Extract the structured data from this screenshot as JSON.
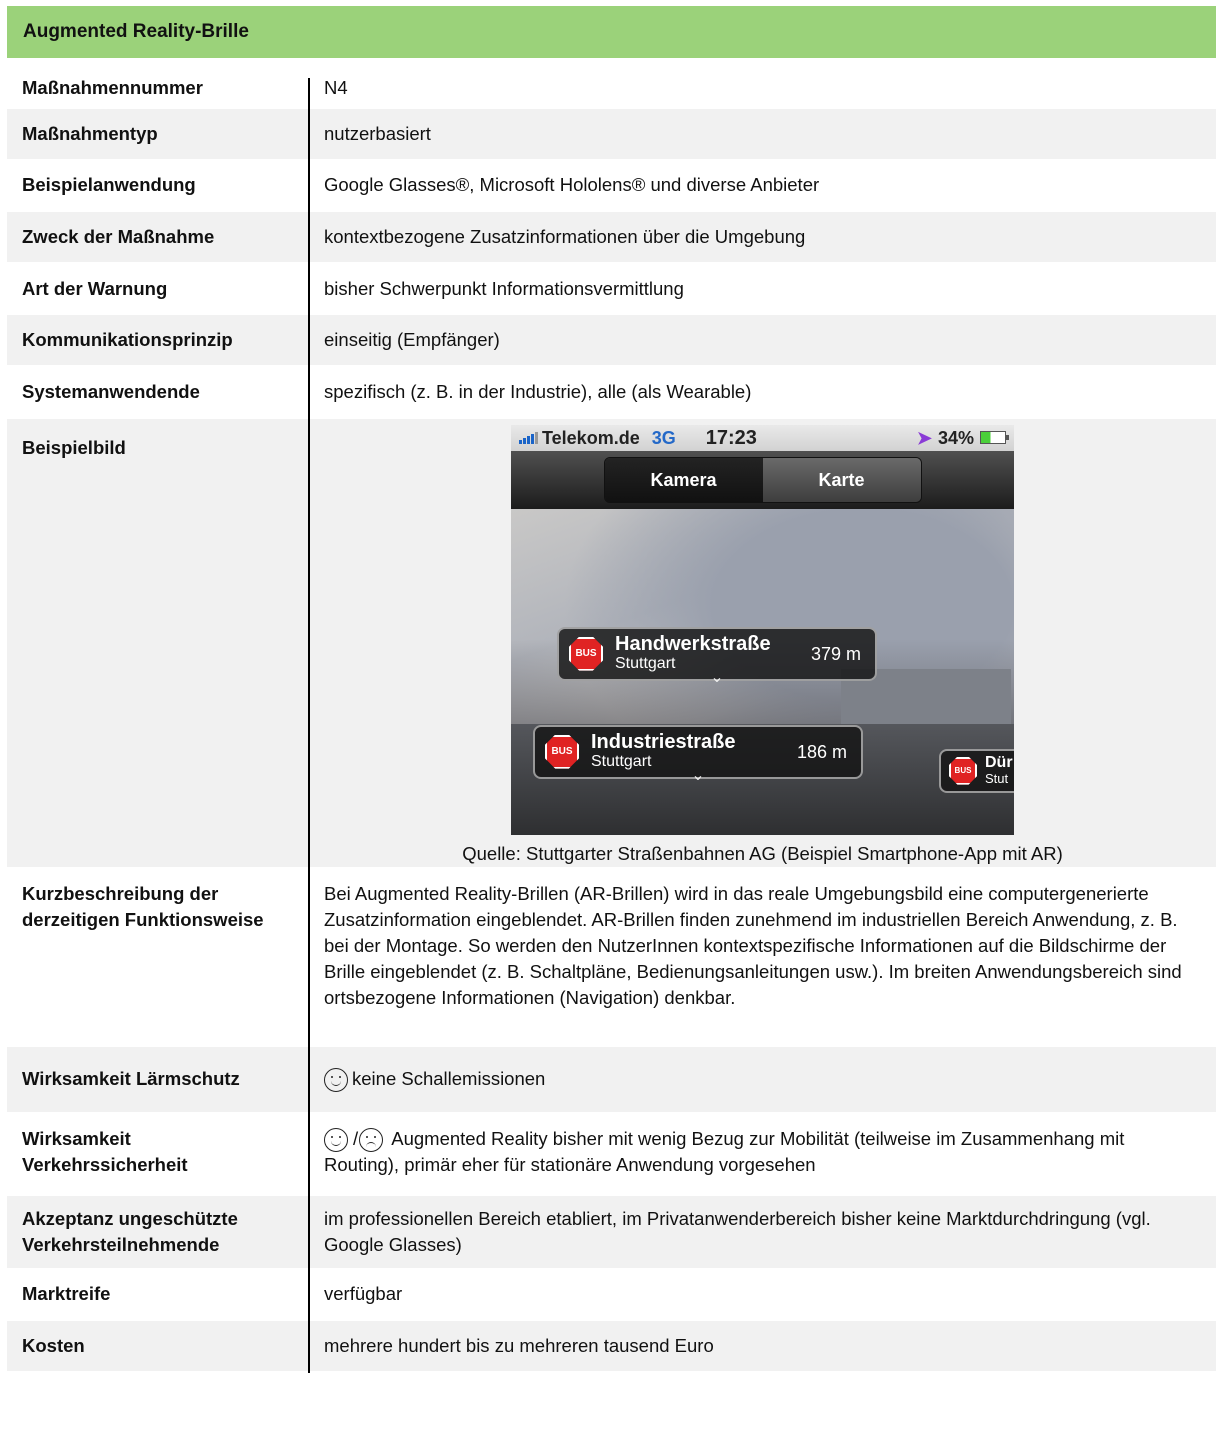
{
  "title": "Augmented Reality-Brille",
  "rows": {
    "nummer": {
      "label": "Maßnahmennummer",
      "value": "N4"
    },
    "typ": {
      "label": "Maßnahmentyp",
      "value": "nutzerbasiert"
    },
    "beispiel": {
      "label": "Beispielanwendung",
      "value": "Google Glasses®, Microsoft Hololens® und diverse Anbieter"
    },
    "zweck": {
      "label": "Zweck der Maßnahme",
      "value": "kontextbezogene Zusatzinformationen über die Umgebung"
    },
    "warnung": {
      "label": "Art der Warnung",
      "value": "bisher Schwerpunkt Informationsvermittlung"
    },
    "kommunikation": {
      "label": "Kommunikationsprinzip",
      "value": "einseitig (Empfänger)"
    },
    "system": {
      "label": "Systemanwendende",
      "value": "spezifisch (z. B. in der Industrie), alle (als Wearable)"
    },
    "bild": {
      "label": "Beispielbild",
      "caption": "Quelle: Stuttgarter Straßenbahnen AG (Beispiel Smartphone-App mit AR)",
      "phone": {
        "carrier": "Telekom.de",
        "network": "3G",
        "time": "17:23",
        "battery": "34%",
        "tab_active": "Kamera",
        "tab_inactive": "Karte",
        "pois": [
          {
            "badge": "BUS",
            "name": "Handwerkstraße",
            "city": "Stuttgart",
            "distance": "379 m"
          },
          {
            "badge": "BUS",
            "name": "Industriestraße",
            "city": "Stuttgart",
            "distance": "186 m"
          },
          {
            "badge": "BUS",
            "name": "Dür",
            "city": "Stut"
          }
        ]
      }
    },
    "beschreibung": {
      "label_line1": "Kurzbeschreibung der",
      "label_line2": "derzeitigen Funktionsweise",
      "value": "Bei Augmented Reality-Brillen (AR-Brillen) wird in das reale Umgebungsbild eine computergenerierte Zusatzinformation eingeblendet. AR-Brillen finden zunehmend im industriellen Bereich Anwendung, z. B. bei der Montage. So werden den NutzerInnen kontextspezifische Informationen auf die Bildschirme der Brille eingeblendet (z. B. Schaltpläne, Bedienungsanleitungen usw.). Im breiten Anwendungsbereich sind ortsbezogene Informationen (Navigation) denkbar."
    },
    "laerm": {
      "label": "Wirksamkeit Lärmschutz",
      "value": "keine Schallemissionen",
      "icon": "happy-smiley-icon"
    },
    "sicherheit": {
      "label_line1": "Wirksamkeit",
      "label_line2": "Verkehrssicherheit",
      "separator": "/",
      "value": "Augmented Reality bisher mit wenig Bezug zur Mobilität (teilweise im Zusammenhang mit Routing), primär eher für stationäre Anwendung vorgesehen",
      "icons": [
        "happy-smiley-icon",
        "sad-smiley-icon"
      ]
    },
    "akzeptanz": {
      "label_line1": "Akzeptanz ungeschützte",
      "label_line2": "Verkehrsteilnehmende",
      "value": "im professionellen Bereich etabliert, im Privatanwenderbereich bisher keine Marktdurchdringung (vgl. Google Glasses)"
    },
    "marktreife": {
      "label": "Marktreife",
      "value": "verfügbar"
    },
    "kosten": {
      "label": "Kosten",
      "value": "mehrere hundert bis zu mehreren tausend Euro"
    }
  },
  "colors": {
    "header_bg": "#9bd27a",
    "row_shade": "#f1f1f1",
    "bus_red": "#e02323"
  }
}
